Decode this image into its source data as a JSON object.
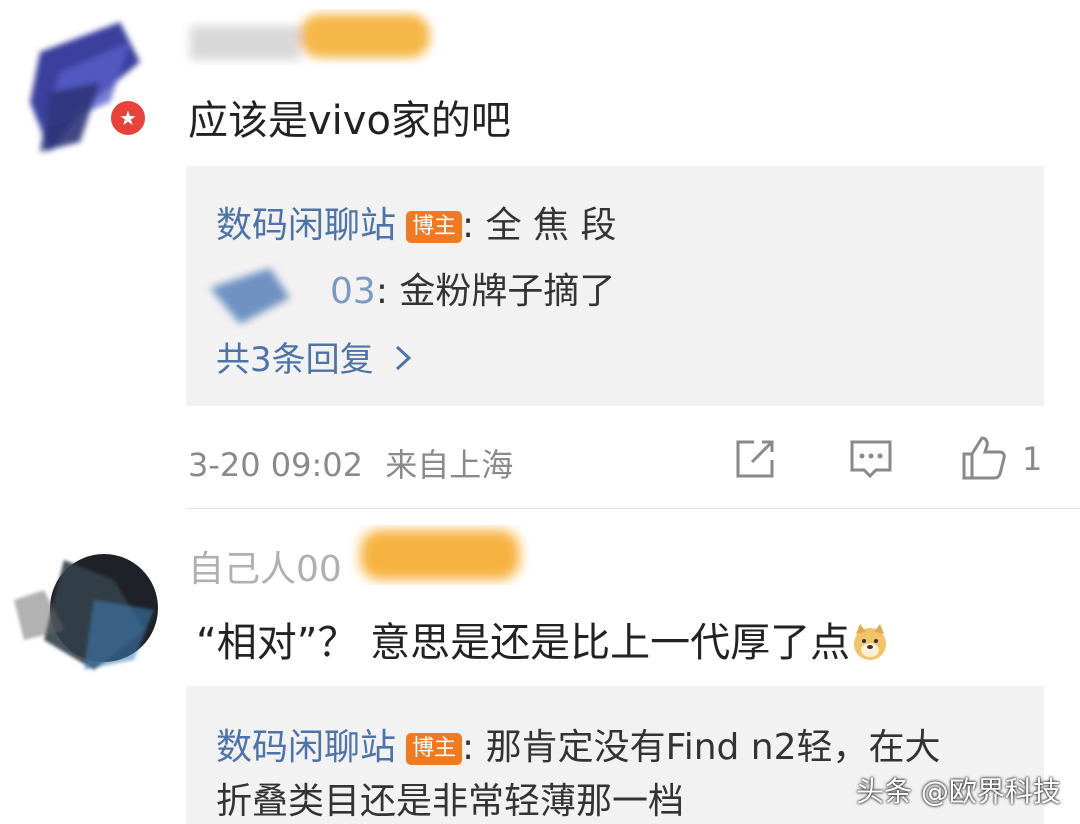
{
  "comments": [
    {
      "text": "应该是vivo家的吧",
      "replies": [
        {
          "author": "数码闲聊站",
          "badge": "博主",
          "text": ": 全 焦 段"
        },
        {
          "author_suffix": "03",
          "text": ": 金粉牌子摘了"
        }
      ],
      "more_replies": "共3条回复",
      "time": "3-20 09:02",
      "location": "来自上海",
      "likes": "1"
    },
    {
      "username": "自己人00",
      "text": "“相对”？ 意思是还是比上一代厚了点",
      "emoji": "doge-emoji",
      "replies": [
        {
          "author": "数码闲聊站",
          "badge": "博主",
          "text_line1": ": 那肯定没有Find n2轻，在大",
          "text_line2": "折叠类目还是非常轻薄那一档"
        }
      ]
    }
  ],
  "icons": {
    "verified": "verified-star-icon",
    "share": "share-icon",
    "comment": "comment-icon",
    "like": "thumbs-up-icon",
    "chevron": "chevron-right-icon"
  },
  "colors": {
    "link": "#4d73a8",
    "badge": "#f07a22",
    "verified": "#e8433a",
    "reply_bg": "#f2f2f2",
    "meta": "#8a8a8a"
  },
  "watermark": "头条 @欧界科技"
}
